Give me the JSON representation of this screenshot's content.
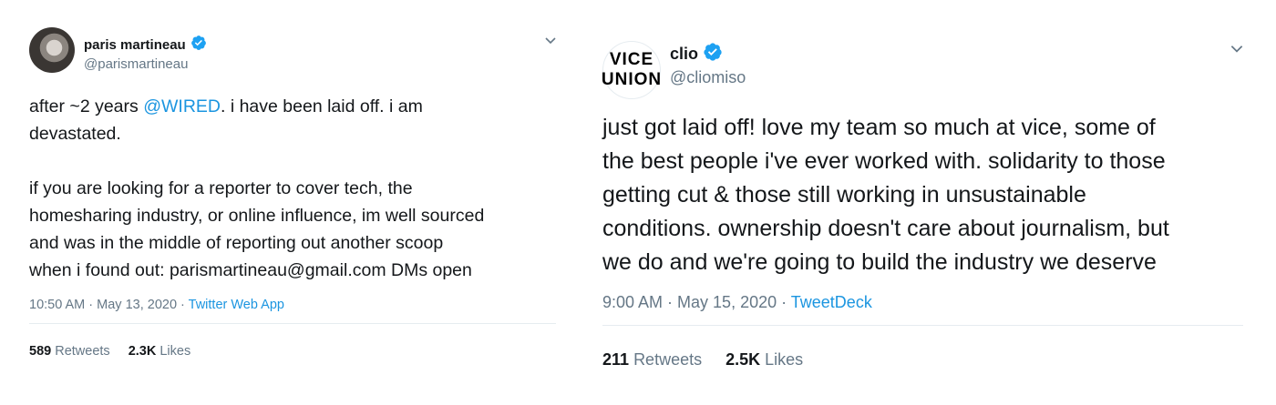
{
  "tweets": [
    {
      "name": "paris martineau",
      "handle": "@parismartineau",
      "body_line1_pre": "after ~2 years ",
      "mention": "@WIRED",
      "body_line1_post": ". i have been laid off. i am\ndevastated.",
      "paragraph2": "if you are looking for a reporter to cover tech, the\nhomesharing industry, or online influence, im well sourced\nand was in the middle of reporting out another scoop\nwhen i found out: parismartineau@gmail.com DMs open",
      "timestamp": "10:50 AM · May 13, 2020 · ",
      "source": "Twitter Web App",
      "retweets_count": "589",
      "retweets_label": "Retweets",
      "likes_count": "2.3K",
      "likes_label": "Likes"
    },
    {
      "name": "clio",
      "handle": "@cliomiso",
      "avatar_line1": "VICE",
      "avatar_line2": "UNION",
      "body": "just got laid off! love my team so much at vice, some of\nthe best people i've ever worked with. solidarity to those\ngetting cut & those still working in unsustainable\nconditions. ownership doesn't care about journalism, but\nwe do and we're going to build the industry we deserve",
      "timestamp": "9:00 AM · May 15, 2020 · ",
      "source": "TweetDeck",
      "retweets_count": "211",
      "retweets_label": "Retweets",
      "likes_count": "2.5K",
      "likes_label": "Likes"
    }
  ],
  "colors": {
    "link": "#1b95e0",
    "verified": "#1da1f2",
    "secondary_text": "#657786",
    "divider": "#e6ecf0"
  },
  "icons": [
    "verified-badge-icon",
    "chevron-down-icon"
  ]
}
